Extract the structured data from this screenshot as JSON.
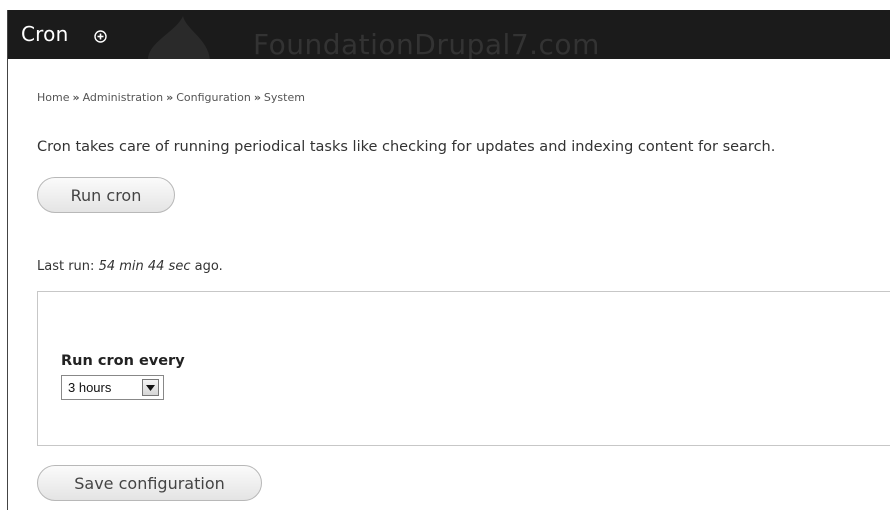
{
  "header": {
    "title": "Cron",
    "watermark": "FoundationDrupal7.com"
  },
  "breadcrumb": {
    "items": [
      "Home",
      "Administration",
      "Configuration",
      "System"
    ],
    "separator": "»"
  },
  "description": "Cron takes care of running periodical tasks like checking for updates and indexing content for search.",
  "run_button_label": "Run cron",
  "last_run": {
    "prefix": "Last run:",
    "value": "54 min 44 sec",
    "suffix": "ago."
  },
  "settings": {
    "field_label": "Run cron every",
    "selected_value": "3 hours"
  },
  "save_button_label": "Save configuration",
  "icons": {
    "shortcut": "add-shortcut-icon",
    "logo": "drupal-drop-icon",
    "select_arrow": "chevron-down-icon"
  }
}
